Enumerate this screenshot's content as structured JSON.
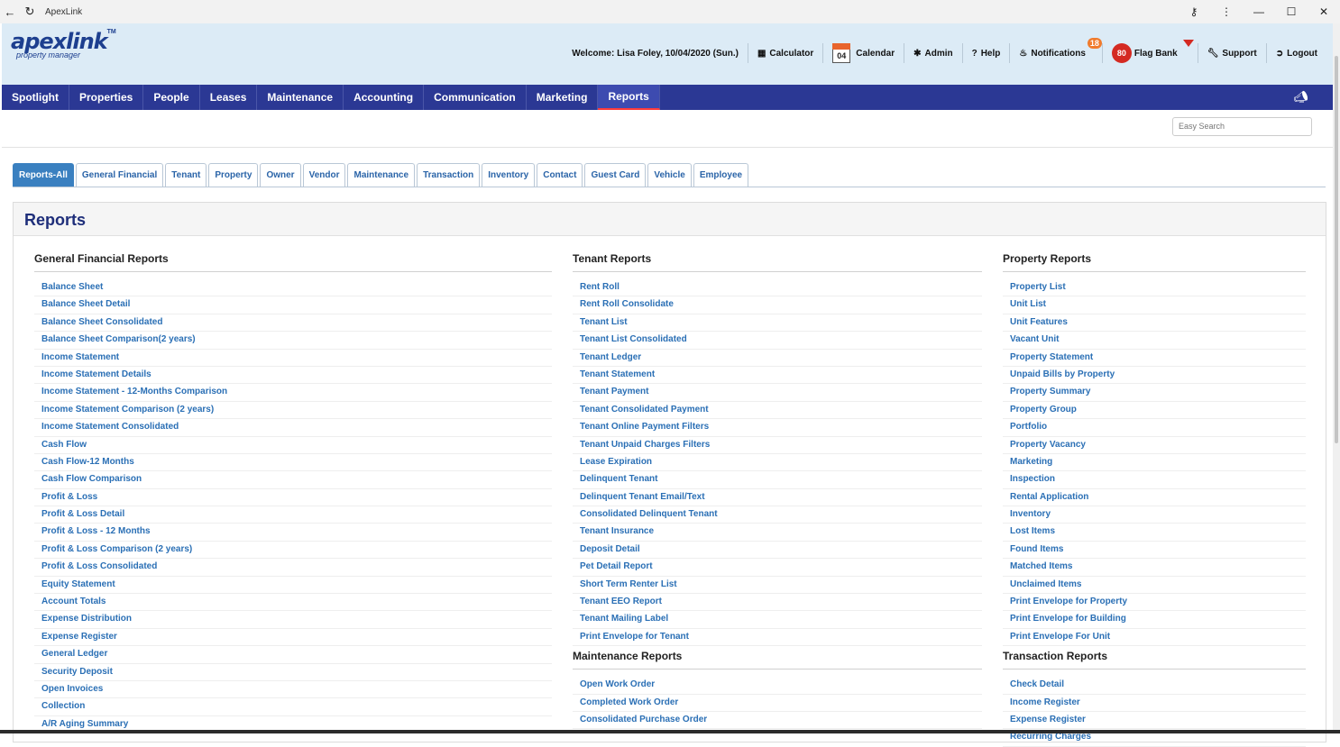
{
  "window": {
    "title": "ApexLink"
  },
  "logo": {
    "name": "apexlink",
    "tm": "TM",
    "tagline": "property manager"
  },
  "header": {
    "welcome": "Welcome: Lisa Foley, 10/04/2020 (Sun.)",
    "calculator": "Calculator",
    "calendar_day": "04",
    "calendar": "Calendar",
    "admin": "Admin",
    "help": "Help",
    "notifications": "Notifications",
    "notifications_count": "18",
    "flag_count": "80",
    "flag_bank": "Flag Bank",
    "support": "Support",
    "logout": "Logout"
  },
  "nav": [
    "Spotlight",
    "Properties",
    "People",
    "Leases",
    "Maintenance",
    "Accounting",
    "Communication",
    "Marketing",
    "Reports"
  ],
  "nav_active": "Reports",
  "search": {
    "placeholder": "Easy Search"
  },
  "tabs": [
    "Reports-All",
    "General Financial",
    "Tenant",
    "Property",
    "Owner",
    "Vendor",
    "Maintenance",
    "Transaction",
    "Inventory",
    "Contact",
    "Guest Card",
    "Vehicle",
    "Employee"
  ],
  "panel": {
    "title": "Reports"
  },
  "sections": {
    "general_financial": {
      "title": "General Financial Reports",
      "links": [
        "Balance Sheet",
        "Balance Sheet Detail",
        "Balance Sheet Consolidated",
        "Balance Sheet Comparison(2 years)",
        "Income Statement",
        "Income Statement Details",
        "Income Statement - 12-Months Comparison",
        "Income Statement Comparison (2 years)",
        "Income Statement Consolidated",
        "Cash Flow",
        "Cash Flow-12 Months",
        "Cash Flow Comparison",
        "Profit & Loss",
        "Profit & Loss Detail",
        "Profit & Loss - 12 Months",
        "Profit & Loss Comparison (2 years)",
        "Profit & Loss Consolidated",
        "Equity Statement",
        "Account Totals",
        "Expense Distribution",
        "Expense Register",
        "General Ledger",
        "Security Deposit",
        "Open Invoices",
        "Collection",
        "A/R Aging Summary"
      ]
    },
    "tenant": {
      "title": "Tenant Reports",
      "links": [
        "Rent Roll",
        "Rent Roll Consolidate",
        "Tenant List",
        "Tenant List Consolidated",
        "Tenant Ledger",
        "Tenant Statement",
        "Tenant Payment",
        "Tenant Consolidated Payment",
        "Tenant Online Payment Filters",
        "Tenant Unpaid Charges Filters",
        "Lease Expiration",
        "Delinquent Tenant",
        "Delinquent Tenant Email/Text",
        "Consolidated Delinquent Tenant",
        "Tenant Insurance",
        "Deposit Detail",
        "Pet Detail Report",
        "Short Term Renter List",
        "Tenant EEO Report",
        "Tenant Mailing Label",
        "Print Envelope for Tenant"
      ]
    },
    "maintenance": {
      "title": "Maintenance Reports",
      "links": [
        "Open Work Order",
        "Completed Work Order",
        "Consolidated Purchase Order"
      ]
    },
    "property": {
      "title": "Property Reports",
      "links": [
        "Property List",
        "Unit List",
        "Unit Features",
        "Vacant Unit",
        "Property Statement",
        "Unpaid Bills by Property",
        "Property Summary",
        "Property Group",
        "Portfolio",
        "Property Vacancy",
        "Marketing",
        "Inspection",
        "Rental Application",
        "Inventory",
        "Lost Items",
        "Found Items",
        "Matched Items",
        "Unclaimed Items",
        "Print Envelope for Property",
        "Print Envelope for Building",
        "Print Envelope For Unit"
      ]
    },
    "transaction": {
      "title": "Transaction Reports",
      "links": [
        "Check Detail",
        "Income Register",
        "Expense Register",
        "Recurring Charges"
      ]
    }
  },
  "colors": {
    "nav_bg": "#2b3894",
    "header_bg": "#dcebf6",
    "link": "#2a6fb5",
    "title": "#1e2e7a",
    "tab_active": "#3a80c0"
  }
}
